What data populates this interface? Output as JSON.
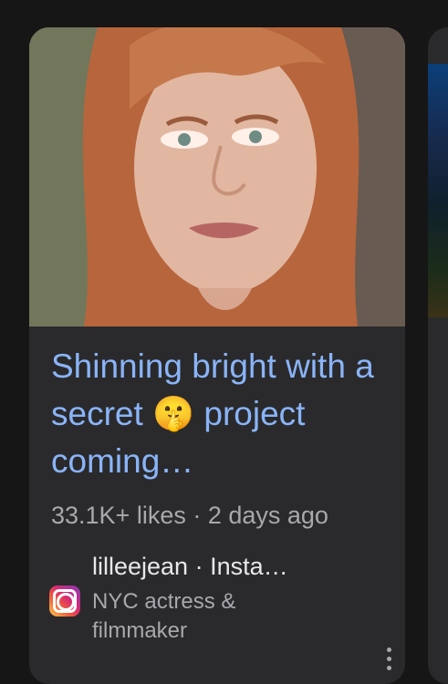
{
  "card": {
    "title": "Shinning bright with a secret 🤫 project coming…",
    "meta": "33.1K+ likes · 2 days ago",
    "source": {
      "name": "lilleejean · Insta…",
      "description": "NYC actress & filmmaker",
      "icon": "instagram-icon"
    }
  },
  "colors": {
    "background": "#161616",
    "card": "#2a2a2c",
    "title": "#8ab4f8",
    "meta": "#a8a8ad"
  }
}
